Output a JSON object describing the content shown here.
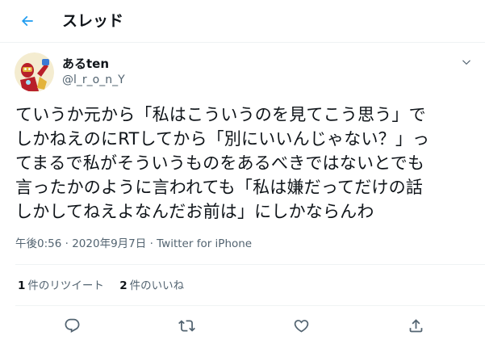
{
  "header": {
    "back_icon": "arrow-left-icon",
    "title": "スレッド",
    "accent_color": "#1d9bf0"
  },
  "tweet": {
    "avatar_icon": "ironman-avatar",
    "display_name": "あるten",
    "handle": "@l_r_o_n_Y",
    "menu_icon": "chevron-down-icon",
    "text": "ていうか元から「私はこういうのを見てこう思う」で\nしかねえのにRTしてから「別にいいんじゃない？」っ\nてまるで私がそういうものをあるべきではないとでも\n言ったかのように言われても「私は嫌だってだけの話\nしかしてねえよなんだお前は」にしかならんわ",
    "time": "午後0:56",
    "separator": "·",
    "date": "2020年9月7日",
    "source": "Twitter for iPhone"
  },
  "stats": {
    "retweets_count": "1",
    "retweets_label": "件のリツイート",
    "likes_count": "2",
    "likes_label": "件のいいね"
  },
  "actions": {
    "reply_icon": "reply-icon",
    "retweet_icon": "retweet-icon",
    "like_icon": "heart-icon",
    "share_icon": "share-icon"
  }
}
